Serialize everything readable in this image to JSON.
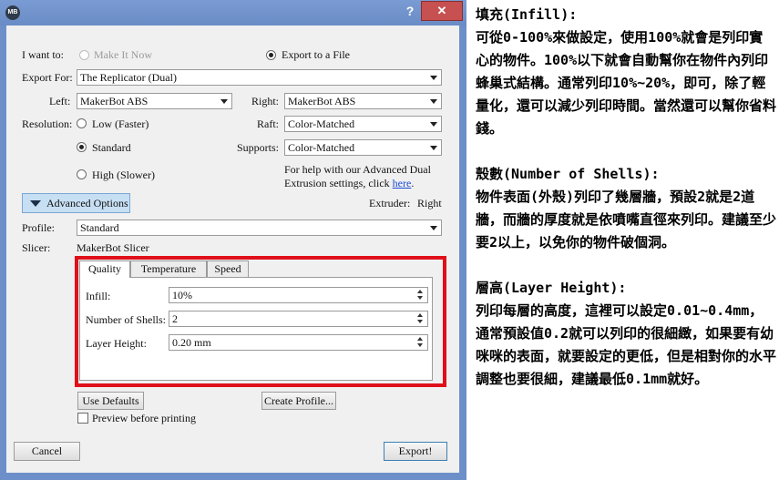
{
  "titlebar": {
    "app_icon": "MB",
    "help": "?",
    "close": "✕"
  },
  "form": {
    "i_want_to_label": "I want to:",
    "make_it_now": "Make It Now",
    "export_to_file": "Export to a File",
    "export_for_label": "Export For:",
    "export_for_value": "The Replicator (Dual)",
    "left_label": "Left:",
    "left_value": "MakerBot ABS",
    "right_label": "Right:",
    "right_value": "MakerBot ABS",
    "resolution_label": "Resolution:",
    "res_low": "Low (Faster)",
    "res_standard": "Standard",
    "res_high": "High (Slower)",
    "raft_label": "Raft:",
    "raft_value": "Color-Matched",
    "supports_label": "Supports:",
    "supports_value": "Color-Matched",
    "help_line1": "For help with our Advanced Dual",
    "help_line2": "Extrusion settings, click",
    "help_link": "here",
    "help_period": "."
  },
  "advanced": {
    "button_label": "Advanced Options",
    "extruder_label": "Extruder:",
    "extruder_value": "Right",
    "profile_label": "Profile:",
    "profile_value": "Standard",
    "slicer_label": "Slicer:",
    "slicer_value": "MakerBot Slicer",
    "tabs": [
      "Quality",
      "Temperature",
      "Speed"
    ],
    "infill_label": "Infill:",
    "infill_value": "10%",
    "shells_label": "Number of Shells:",
    "shells_value": "2",
    "layer_label": "Layer Height:",
    "layer_value": "0.20 mm",
    "use_defaults": "Use Defaults",
    "create_profile": "Create Profile...",
    "preview": "Preview before printing"
  },
  "footer": {
    "cancel": "Cancel",
    "export": "Export!"
  },
  "notes": {
    "infill_title": "填充(Infill):",
    "infill_body": "可從0-100%來做設定，使用100%就會是列印實心的物件。100%以下就會自動幫你在物件內列印蜂巢式結構。通常列印10%~20%，即可，除了輕量化，還可以減少列印時間。當然還可以幫你省料錢。",
    "shells_title": "殼數(Number of Shells):",
    "shells_body": "物件表面(外殼)列印了幾層牆，預設2就是2道牆，而牆的厚度就是依噴嘴直徑來列印。建議至少要2以上，以免你的物件破個洞。",
    "layer_title": "層高(Layer Height):",
    "layer_body": "列印每層的高度，這裡可以設定0.01~0.4mm，通常預設值0.2就可以列印的很細緻，如果要有幼咪咪的表面，就要設定的更低，但是相對你的水平調整也要很細，建議最低0.1mm就好。"
  },
  "colors": {
    "titlebar": "#6d8fc9",
    "close": "#c75050",
    "highlight_box": "#e0101a",
    "advanced_button": "#c7dff3"
  }
}
